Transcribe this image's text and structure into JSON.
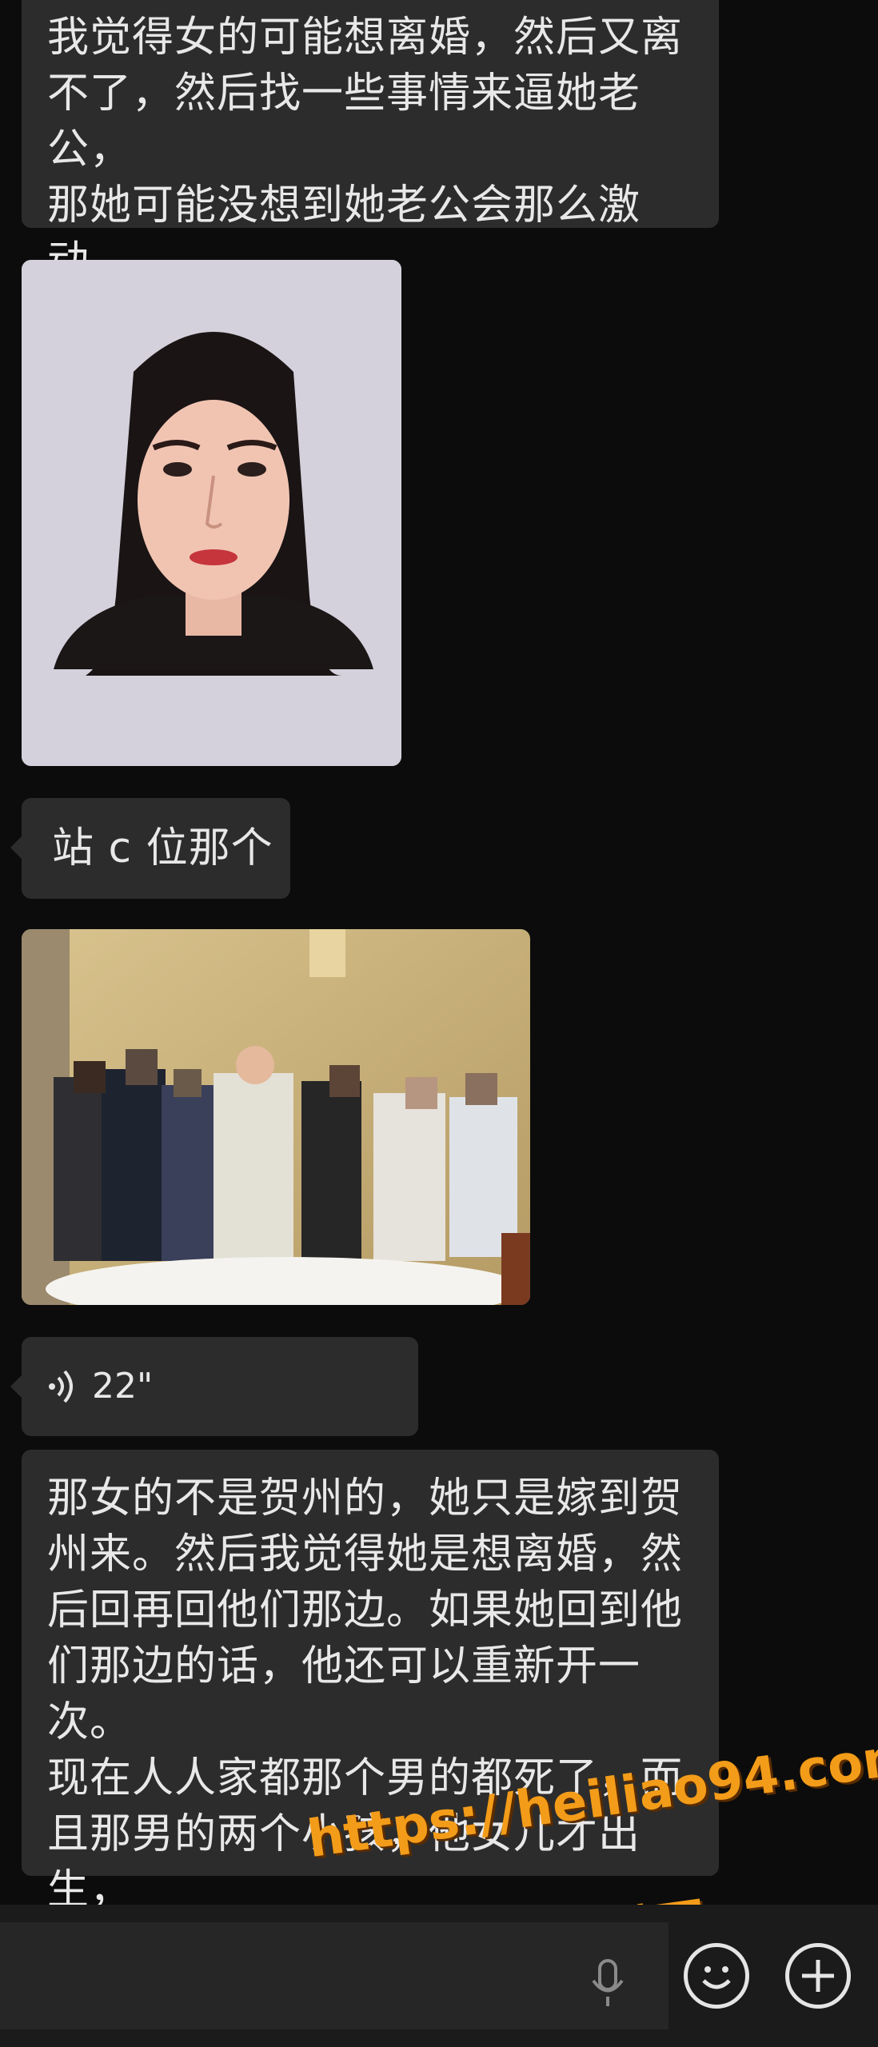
{
  "messages": {
    "top_text": "我觉得女的可能想离婚，然后又离\n不了，然后找一些事情来逼她老公，\n那她可能没想到她老公会那么激动，\n把人杀死了。嗯",
    "c_position_text": "站 c 位那个",
    "voice_duration": "22\"",
    "bottom_text": "那女的不是贺州的，她只是嫁到贺\n州来。然后我觉得她是想离婚，然\n后回再回他们那边。如果她回到他\n们那边的话，他还可以重新开一次。\n现在人人家都那个男的都死了，而\n且那男的两个小孩，他女儿才出生，\n才满月没多久。"
  },
  "watermark": {
    "url": "https://heiliao94.com",
    "site_name": "黑料网"
  },
  "colors": {
    "background": "#0c0c0c",
    "bubble": "#2c2c2c",
    "text": "#e8e8e8",
    "watermark": "#f39c19"
  },
  "icons": [
    "voice-wave-icon",
    "microphone-icon",
    "emoji-icon",
    "plus-icon"
  ]
}
